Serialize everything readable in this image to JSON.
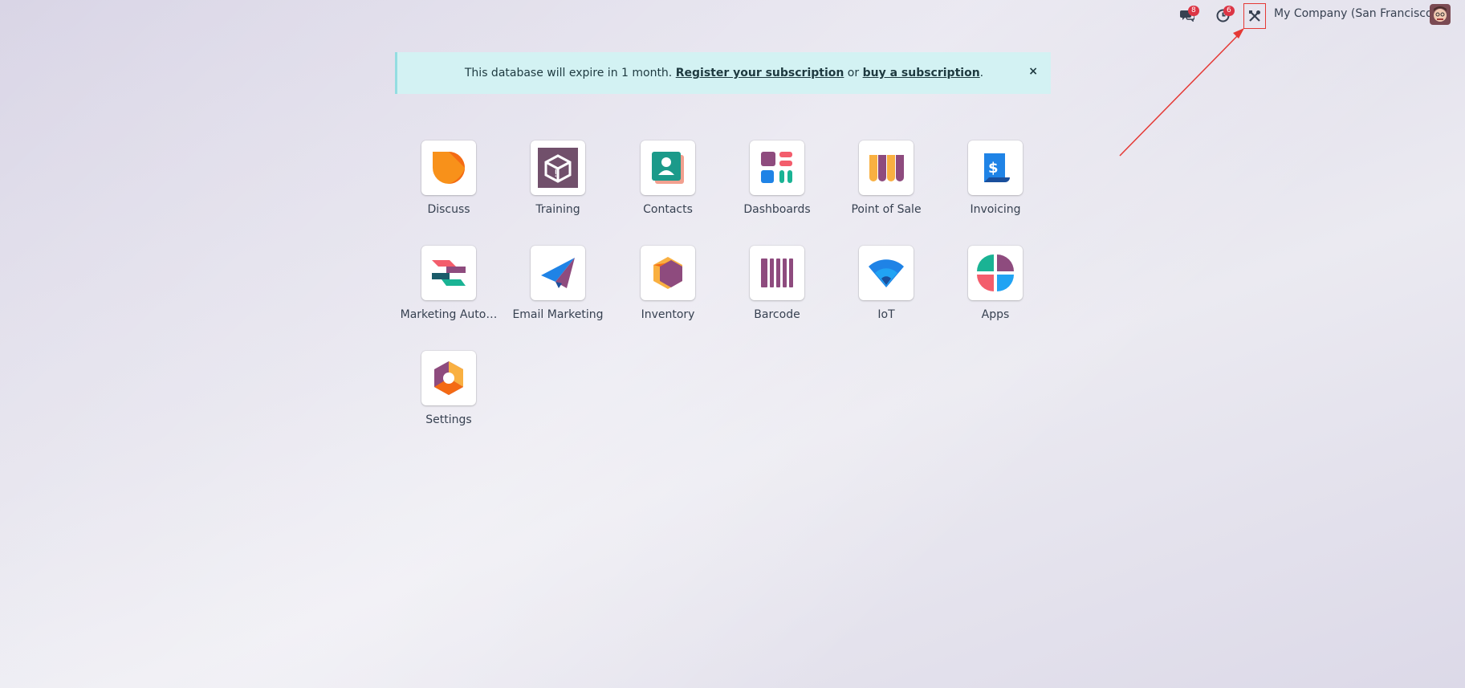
{
  "navbar": {
    "chat_badge": "8",
    "activity_badge": "6",
    "company_name": "My Company (San Francisco)"
  },
  "banner": {
    "text_before": "This database will expire in 1 month. ",
    "register_link": "Register your subscription",
    "text_middle": " or ",
    "buy_link": "buy a subscription",
    "text_after": ".",
    "close_label": "×"
  },
  "apps": [
    {
      "label": "Discuss",
      "icon": "discuss-icon"
    },
    {
      "label": "Training",
      "icon": "training-icon"
    },
    {
      "label": "Contacts",
      "icon": "contacts-icon"
    },
    {
      "label": "Dashboards",
      "icon": "dashboards-icon"
    },
    {
      "label": "Point of Sale",
      "icon": "point-of-sale-icon"
    },
    {
      "label": "Invoicing",
      "icon": "invoicing-icon"
    },
    {
      "label": "Marketing Auto…",
      "icon": "marketing-automation-icon"
    },
    {
      "label": "Email Marketing",
      "icon": "email-marketing-icon"
    },
    {
      "label": "Inventory",
      "icon": "inventory-icon"
    },
    {
      "label": "Barcode",
      "icon": "barcode-icon"
    },
    {
      "label": "IoT",
      "icon": "iot-icon"
    },
    {
      "label": "Apps",
      "icon": "apps-icon"
    },
    {
      "label": "Settings",
      "icon": "settings-icon"
    }
  ],
  "colors": {
    "annotation": "#e53935",
    "badge": "#dc3545",
    "banner_bg": "#d3f2f3"
  }
}
